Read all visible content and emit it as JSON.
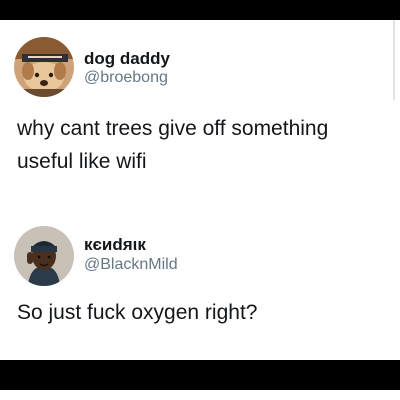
{
  "tweets": [
    {
      "name": "dog daddy",
      "handle": "@broebong",
      "text_lines": [
        "why cant trees give off something",
        "useful like wifi"
      ]
    },
    {
      "name": "кєиdяιк",
      "handle": "@BlacknMild",
      "text_lines": [
        "So just fuck oxygen right?"
      ]
    }
  ]
}
